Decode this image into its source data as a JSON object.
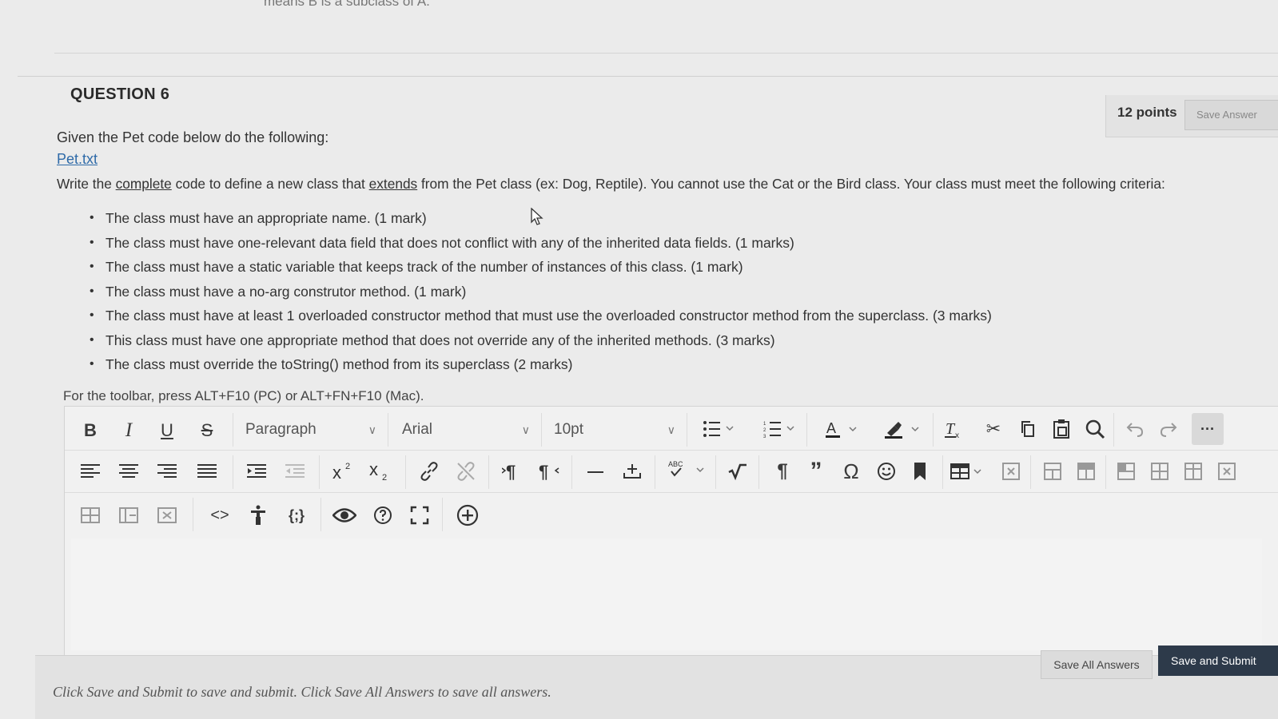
{
  "top_cut_text": "means B is a subclass of A.",
  "question": {
    "title": "QUESTION 6",
    "points": "12 points",
    "save_answer": "Save Answer"
  },
  "content": {
    "intro": "Given the Pet code below do the following:",
    "link": "Pet.txt",
    "write_pre": "Write the ",
    "write_u1": "complete",
    "write_mid": " code to define a new class that ",
    "write_u2": "extends",
    "write_post": " from the Pet class (ex: Dog, Reptile). You cannot use the Cat or the Bird class. Your class must meet the following criteria:",
    "criteria": [
      "The class must have an appropriate name. (1 mark)",
      "The class must have one-relevant data field that does not conflict with any of the inherited data fields. (1 marks)",
      "The class must have a static variable that keeps track of the number of instances of this class. (1 mark)",
      "The class must have a no-arg construtor method. (1 mark)",
      "The class must have at least 1 overloaded constructor method that must use the overloaded constructor method from the superclass. (3 marks)",
      "This class must have one appropriate method that does not override any of the inherited methods. (3 marks)",
      "The class must override the toString() method from its superclass (2 marks)"
    ]
  },
  "editor": {
    "toolbar_help": "For the toolbar, press ALT+F10 (PC) or ALT+FN+F10 (Mac).",
    "block_format": "Paragraph",
    "font_family": "Arial",
    "font_size": "10pt",
    "bold": "B",
    "italic": "I",
    "underline": "U",
    "strike": "S",
    "more": "···",
    "spell_label": "ABC"
  },
  "footer": {
    "note": "Click Save and Submit to save and submit. Click Save All Answers to save all answers.",
    "save_all": "Save All Answers",
    "save_submit": "Save and Submit"
  }
}
